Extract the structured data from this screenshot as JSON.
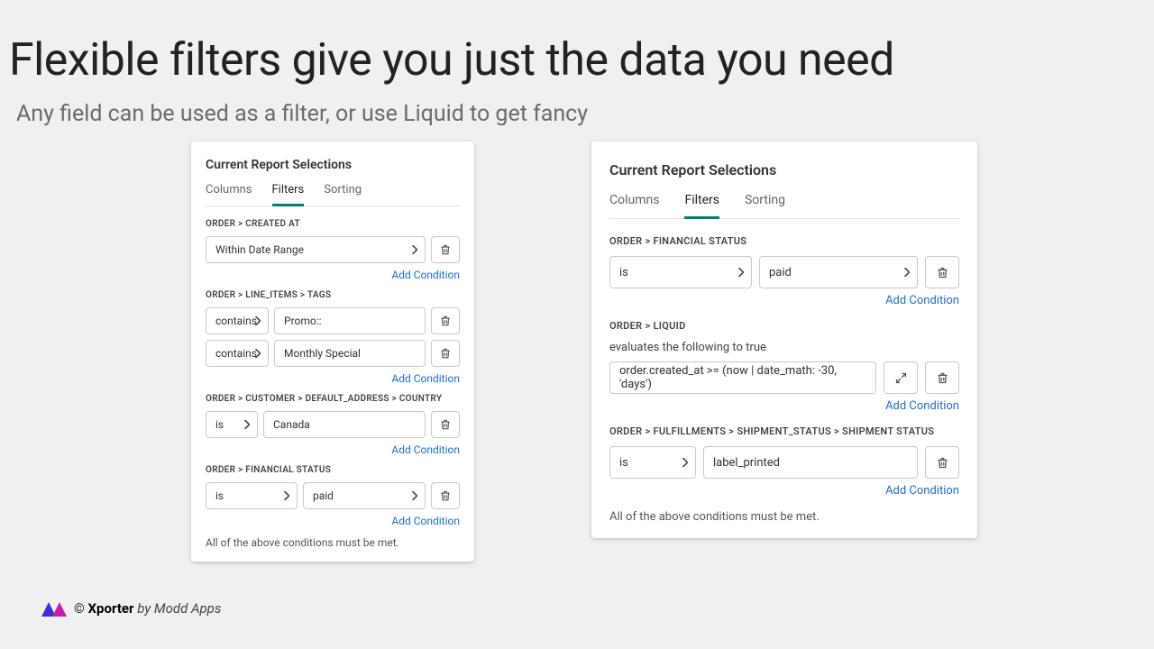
{
  "headline": "Flexible filters give you just the data you need",
  "subhead": "Any field can be used as a filter, or use Liquid to get fancy",
  "cardLeft": {
    "title": "Current Report Selections",
    "tabs": {
      "columns": "Columns",
      "filters": "Filters",
      "sorting": "Sorting"
    },
    "sections": [
      {
        "label": "ORDER > CREATED AT",
        "rows": [
          {
            "op": "Within Date Range"
          }
        ],
        "add": "Add Condition"
      },
      {
        "label": "ORDER > LINE_ITEMS > TAGS",
        "rows": [
          {
            "op": "contains",
            "val": "Promo::"
          },
          {
            "op": "contains",
            "val": "Monthly Special"
          }
        ],
        "add": "Add Condition"
      },
      {
        "label": "ORDER > CUSTOMER > DEFAULT_ADDRESS > COUNTRY",
        "rows": [
          {
            "op": "is",
            "val": "Canada"
          }
        ],
        "add": "Add Condition"
      },
      {
        "label": "ORDER > FINANCIAL STATUS",
        "rows": [
          {
            "op": "is",
            "valSelect": "paid"
          }
        ],
        "add": "Add Condition"
      }
    ],
    "footer": "All of the above conditions must be met."
  },
  "cardRight": {
    "title": "Current Report Selections",
    "tabs": {
      "columns": "Columns",
      "filters": "Filters",
      "sorting": "Sorting"
    },
    "sections": [
      {
        "label": "ORDER > FINANCIAL STATUS",
        "rows": [
          {
            "op": "is",
            "valSelect": "paid"
          }
        ],
        "add": "Add Condition"
      },
      {
        "label": "ORDER > LIQUID",
        "plaintext": "evaluates the following to true",
        "rows": [
          {
            "liquid": "order.created_at >= (now | date_math: -30, 'days')"
          }
        ],
        "add": "Add Condition"
      },
      {
        "label": "ORDER > FULFILLMENTS > SHIPMENT_STATUS > SHIPMENT STATUS",
        "rows": [
          {
            "op": "is",
            "val": "label_printed"
          }
        ],
        "add": "Add Condition"
      }
    ],
    "footer": "All of the above conditions must be met."
  },
  "branding": {
    "copy": "©",
    "name": "Xporter",
    "by": "by Modd Apps"
  }
}
